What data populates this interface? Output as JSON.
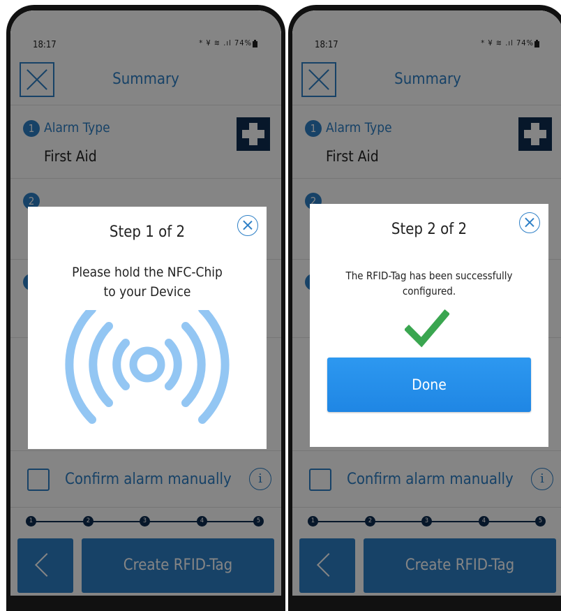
{
  "screens": {
    "left": {
      "status": {
        "time": "18:17",
        "icons": "* ¥ ≋ .ıl",
        "battery": "74%"
      },
      "header": {
        "title": "Summary"
      },
      "alarm": {
        "number": "1",
        "label": "Alarm Type",
        "value": "First Aid"
      },
      "section2": {
        "number": "2"
      },
      "section3": {
        "number": "3"
      },
      "confirm": {
        "label": "Confirm alarm manually",
        "info": "i"
      },
      "steps": [
        "1",
        "2",
        "3",
        "4",
        "5"
      ],
      "create_button": "Create RFID-Tag",
      "modal": {
        "title": "Step 1 of 2",
        "line1": "Please hold the NFC-Chip",
        "line2": "to your Device"
      }
    },
    "right": {
      "status": {
        "time": "18:17",
        "icons": "* ¥ ≋ .ıl",
        "battery": "74%"
      },
      "header": {
        "title": "Summary"
      },
      "alarm": {
        "number": "1",
        "label": "Alarm Type",
        "value": "First Aid"
      },
      "section2": {
        "number": "2"
      },
      "section3": {
        "number": "3"
      },
      "confirm": {
        "label": "Confirm alarm manually",
        "info": "i"
      },
      "steps": [
        "1",
        "2",
        "3",
        "4",
        "5"
      ],
      "create_button": "Create RFID-Tag",
      "modal": {
        "title": "Step 2 of 2",
        "line1": "The RFID-Tag has been successfully",
        "line2": "configured.",
        "done_button": "Done"
      }
    }
  },
  "colors": {
    "brand_blue": "#2d7fc6",
    "dark_navy": "#0f2d52",
    "nfc_waves": "#93c6f3",
    "success_green": "#3aa650",
    "done_blue": "#2590ea"
  },
  "icons": {
    "close": "close-x-icon",
    "first_aid": "first-aid-cross-icon",
    "info": "info-icon",
    "nfc": "nfc-waves-icon",
    "success": "checkmark-icon",
    "back": "chevron-left-icon"
  }
}
